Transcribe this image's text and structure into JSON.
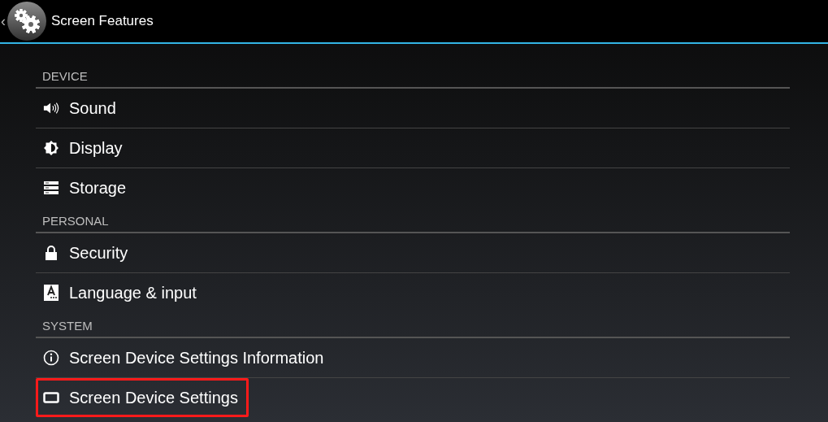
{
  "header": {
    "title": "Screen Features",
    "back_glyph": "‹"
  },
  "sections": [
    {
      "title": "DEVICE",
      "items": [
        {
          "label": "Sound",
          "kind": "sound",
          "highlighted": false
        },
        {
          "label": "Display",
          "kind": "display",
          "highlighted": false
        },
        {
          "label": "Storage",
          "kind": "storage",
          "highlighted": false
        }
      ]
    },
    {
      "title": "PERSONAL",
      "items": [
        {
          "label": "Security",
          "kind": "lock",
          "highlighted": false
        },
        {
          "label": "Language & input",
          "kind": "language",
          "highlighted": false
        }
      ]
    },
    {
      "title": "SYSTEM",
      "items": [
        {
          "label": "Screen Device Settings Information",
          "kind": "info",
          "highlighted": false
        },
        {
          "label": "Screen Device Settings",
          "kind": "screen",
          "highlighted": true
        }
      ]
    }
  ]
}
